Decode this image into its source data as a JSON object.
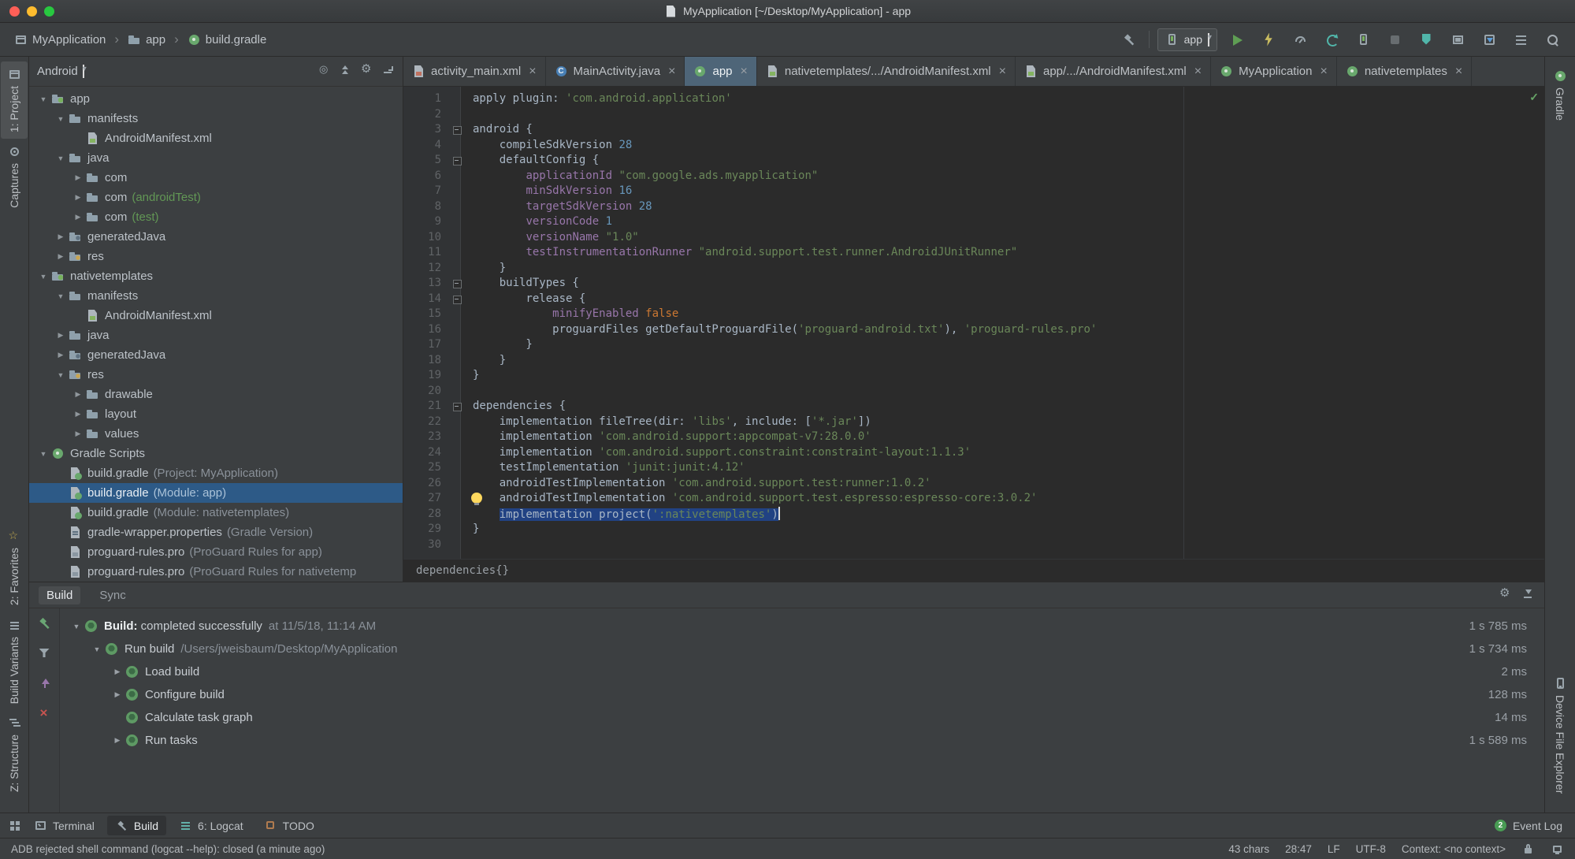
{
  "title_bar": {
    "title": "MyApplication [~/Desktop/MyApplication] - app"
  },
  "toolbar": {
    "breadcrumbs": [
      {
        "label": "MyApplication",
        "icon": "project-window"
      },
      {
        "label": "app",
        "icon": "folder"
      },
      {
        "label": "build.gradle",
        "icon": "gradle"
      }
    ],
    "run_config": "app",
    "icons_before": [
      "build-hammer"
    ],
    "icons_after": [
      "run-play",
      "apply-changes",
      "profiler",
      "gradle-sync",
      "avd-manager",
      "stop",
      "attach-debugger",
      "layout-inspector",
      "sdk-manager",
      "project-structure",
      "search"
    ]
  },
  "left_strip": {
    "top": [
      {
        "label": "1: Project",
        "icon": "project",
        "active": true
      },
      {
        "label": "Captures",
        "icon": "captures",
        "active": false
      }
    ],
    "bottom": [
      {
        "label": "2: Favorites",
        "icon": "favorites",
        "active": false
      },
      {
        "label": "Build Variants",
        "icon": "build-variants",
        "active": false
      },
      {
        "label": "Z: Structure",
        "icon": "structure",
        "active": false
      }
    ]
  },
  "right_strip": {
    "top": [
      {
        "label": "Gradle",
        "icon": "gradle",
        "active": false
      }
    ],
    "bottom": [
      {
        "label": "Device File Explorer",
        "icon": "device-explorer",
        "active": false
      }
    ]
  },
  "project_panel": {
    "view_selector": "Android",
    "header_icons": [
      "locate",
      "collapse-all",
      "settings",
      "hide"
    ],
    "tree": [
      {
        "label": "app",
        "indent": 0,
        "icon": "module",
        "arrow": "down"
      },
      {
        "label": "manifests",
        "indent": 1,
        "icon": "folder",
        "arrow": "down"
      },
      {
        "label": "AndroidManifest.xml",
        "indent": 2,
        "icon": "manifest-file",
        "arrow": null
      },
      {
        "label": "java",
        "indent": 1,
        "icon": "folder",
        "arrow": "down"
      },
      {
        "label": "com",
        "indent": 2,
        "icon": "package",
        "arrow": "right"
      },
      {
        "label": "com",
        "suffix": " (androidTest)",
        "suffix_green": true,
        "indent": 2,
        "icon": "package",
        "arrow": "right"
      },
      {
        "label": "com",
        "suffix": " (test)",
        "suffix_green": true,
        "indent": 2,
        "icon": "package",
        "arrow": "right"
      },
      {
        "label": "generatedJava",
        "indent": 1,
        "icon": "folder-gen",
        "arrow": "right"
      },
      {
        "label": "res",
        "indent": 1,
        "icon": "folder-res",
        "arrow": "right"
      },
      {
        "label": "nativetemplates",
        "indent": 0,
        "icon": "module",
        "arrow": "down"
      },
      {
        "label": "manifests",
        "indent": 1,
        "icon": "folder",
        "arrow": "down"
      },
      {
        "label": "AndroidManifest.xml",
        "indent": 2,
        "icon": "manifest-file",
        "arrow": null
      },
      {
        "label": "java",
        "indent": 1,
        "icon": "folder",
        "arrow": "right"
      },
      {
        "label": "generatedJava",
        "indent": 1,
        "icon": "folder-gen",
        "arrow": "right"
      },
      {
        "label": "res",
        "indent": 1,
        "icon": "folder-res",
        "arrow": "down"
      },
      {
        "label": "drawable",
        "indent": 2,
        "icon": "folder",
        "arrow": "right"
      },
      {
        "label": "layout",
        "indent": 2,
        "icon": "folder",
        "arrow": "right"
      },
      {
        "label": "values",
        "indent": 2,
        "icon": "folder",
        "arrow": "right"
      },
      {
        "label": "Gradle Scripts",
        "indent": 0,
        "icon": "gradle",
        "arrow": "down"
      },
      {
        "label": "build.gradle",
        "suffix": " (Project: MyApplication)",
        "indent": 1,
        "icon": "gradle-file",
        "arrow": null
      },
      {
        "label": "build.gradle",
        "suffix": " (Module: app)",
        "indent": 1,
        "icon": "gradle-file",
        "arrow": null,
        "selected": true
      },
      {
        "label": "build.gradle",
        "suffix": " (Module: nativetemplates)",
        "indent": 1,
        "icon": "gradle-file",
        "arrow": null
      },
      {
        "label": "gradle-wrapper.properties",
        "suffix": " (Gradle Version)",
        "indent": 1,
        "icon": "props-file",
        "arrow": null
      },
      {
        "label": "proguard-rules.pro",
        "suffix": " (ProGuard Rules for app)",
        "indent": 1,
        "icon": "pro-file",
        "arrow": null
      },
      {
        "label": "proguard-rules.pro",
        "suffix": " (ProGuard Rules for nativetemp",
        "indent": 1,
        "icon": "pro-file",
        "arrow": null
      }
    ]
  },
  "editor": {
    "tabs": [
      {
        "label": "activity_main.xml",
        "icon": "xml-file",
        "active": false
      },
      {
        "label": "MainActivity.java",
        "icon": "java-class",
        "active": false
      },
      {
        "label": "app",
        "icon": "gradle",
        "active": true
      },
      {
        "label": "nativetemplates/.../AndroidManifest.xml",
        "icon": "manifest-file",
        "active": false
      },
      {
        "label": "app/.../AndroidManifest.xml",
        "icon": "manifest-file",
        "active": false
      },
      {
        "label": "MyApplication",
        "icon": "gradle",
        "active": false
      },
      {
        "label": "nativetemplates",
        "icon": "gradle",
        "active": false
      }
    ],
    "breadcrumb": "dependencies{}",
    "lines": [
      {
        "n": 1,
        "seg": [
          [
            "apply plugin: ",
            "d"
          ],
          [
            "'com.android.application'",
            "s"
          ]
        ]
      },
      {
        "n": 2,
        "seg": []
      },
      {
        "n": 3,
        "fold": true,
        "seg": [
          [
            "android {",
            "d"
          ]
        ]
      },
      {
        "n": 4,
        "seg": [
          [
            "    compileSdkVersion ",
            "d"
          ],
          [
            "28",
            "n"
          ]
        ]
      },
      {
        "n": 5,
        "fold": true,
        "seg": [
          [
            "    defaultConfig {",
            "d"
          ]
        ]
      },
      {
        "n": 6,
        "seg": [
          [
            "        ",
            "d"
          ],
          [
            "applicationId ",
            "f"
          ],
          [
            "\"com.google.ads.myapplication\"",
            "s"
          ]
        ]
      },
      {
        "n": 7,
        "seg": [
          [
            "        ",
            "d"
          ],
          [
            "minSdkVersion ",
            "f"
          ],
          [
            "16",
            "n"
          ]
        ]
      },
      {
        "n": 8,
        "seg": [
          [
            "        ",
            "d"
          ],
          [
            "targetSdkVersion ",
            "f"
          ],
          [
            "28",
            "n"
          ]
        ]
      },
      {
        "n": 9,
        "seg": [
          [
            "        ",
            "d"
          ],
          [
            "versionCode ",
            "f"
          ],
          [
            "1",
            "n"
          ]
        ]
      },
      {
        "n": 10,
        "seg": [
          [
            "        ",
            "d"
          ],
          [
            "versionName ",
            "f"
          ],
          [
            "\"1.0\"",
            "s"
          ]
        ]
      },
      {
        "n": 11,
        "seg": [
          [
            "        ",
            "d"
          ],
          [
            "testInstrumentationRunner ",
            "f"
          ],
          [
            "\"android.support.test.runner.AndroidJUnitRunner\"",
            "s"
          ]
        ]
      },
      {
        "n": 12,
        "seg": [
          [
            "    }",
            "d"
          ]
        ]
      },
      {
        "n": 13,
        "fold": true,
        "seg": [
          [
            "    buildTypes {",
            "d"
          ]
        ]
      },
      {
        "n": 14,
        "fold": true,
        "seg": [
          [
            "        release {",
            "d"
          ]
        ]
      },
      {
        "n": 15,
        "seg": [
          [
            "            ",
            "d"
          ],
          [
            "minifyEnabled ",
            "f"
          ],
          [
            "false",
            "k"
          ]
        ]
      },
      {
        "n": 16,
        "seg": [
          [
            "            proguardFiles getDefaultProguardFile(",
            "d"
          ],
          [
            "'proguard-android.txt'",
            "s"
          ],
          [
            "), ",
            "d"
          ],
          [
            "'proguard-rules.pro'",
            "s"
          ]
        ]
      },
      {
        "n": 17,
        "seg": [
          [
            "        }",
            "d"
          ]
        ]
      },
      {
        "n": 18,
        "seg": [
          [
            "    }",
            "d"
          ]
        ]
      },
      {
        "n": 19,
        "seg": [
          [
            "}",
            "d"
          ]
        ]
      },
      {
        "n": 20,
        "seg": []
      },
      {
        "n": 21,
        "fold": true,
        "seg": [
          [
            "dependencies {",
            "d"
          ]
        ]
      },
      {
        "n": 22,
        "seg": [
          [
            "    implementation fileTree(dir: ",
            "d"
          ],
          [
            "'libs'",
            "s"
          ],
          [
            ", include: [",
            "d"
          ],
          [
            "'*.jar'",
            "s"
          ],
          [
            "])",
            "d"
          ]
        ]
      },
      {
        "n": 23,
        "seg": [
          [
            "    implementation ",
            "d"
          ],
          [
            "'com.android.support:appcompat-v7:28.0.0'",
            "s"
          ]
        ]
      },
      {
        "n": 24,
        "seg": [
          [
            "    implementation ",
            "d"
          ],
          [
            "'com.android.support.constraint:constraint-layout:1.1.3'",
            "s"
          ]
        ]
      },
      {
        "n": 25,
        "seg": [
          [
            "    testImplementation ",
            "d"
          ],
          [
            "'junit:junit:4.12'",
            "s"
          ]
        ]
      },
      {
        "n": 26,
        "seg": [
          [
            "    androidTestImplementation ",
            "d"
          ],
          [
            "'com.android.support.test:runner:1.0.2'",
            "s"
          ]
        ]
      },
      {
        "n": 27,
        "bulb": true,
        "seg": [
          [
            "    androidTestImplementation ",
            "d"
          ],
          [
            "'com.android.support.test.espresso:espresso-core:3.0.2'",
            "s"
          ]
        ]
      },
      {
        "n": 28,
        "caret": true,
        "seg": [
          [
            "    ",
            "d"
          ],
          [
            "implementation project(",
            "ds"
          ],
          [
            "':nativetemplates'",
            "ss"
          ],
          [
            ")",
            "ds"
          ]
        ]
      },
      {
        "n": 29,
        "seg": [
          [
            "}",
            "d"
          ]
        ]
      },
      {
        "n": 30,
        "seg": []
      }
    ]
  },
  "build_panel": {
    "tabs": [
      {
        "label": "Build",
        "active": true
      },
      {
        "label": "Sync",
        "active": false
      }
    ],
    "header_icons": [
      "settings",
      "minimize"
    ],
    "side_icons": [
      "rerun-build",
      "filter",
      "export",
      "close"
    ],
    "rows": [
      {
        "indent": 0,
        "arrow": "down",
        "bold": "Build:",
        "label": " completed successfully",
        "meta": " at 11/5/18, 11:14 AM",
        "time": "1 s 785 ms"
      },
      {
        "indent": 1,
        "arrow": "down",
        "bold": "",
        "label": "Run build",
        "meta": " /Users/jweisbaum/Desktop/MyApplication",
        "time": "1 s 734 ms"
      },
      {
        "indent": 2,
        "arrow": "right",
        "bold": "",
        "label": "Load build",
        "meta": "",
        "time": "2 ms"
      },
      {
        "indent": 2,
        "arrow": "right",
        "bold": "",
        "label": "Configure build",
        "meta": "",
        "time": "128 ms"
      },
      {
        "indent": 2,
        "arrow": "none",
        "bold": "",
        "label": "Calculate task graph",
        "meta": "",
        "time": "14 ms"
      },
      {
        "indent": 2,
        "arrow": "right",
        "bold": "",
        "label": "Run tasks",
        "meta": "",
        "time": "1 s 589 ms"
      }
    ]
  },
  "bottom_bar": {
    "items": [
      {
        "label": "Terminal",
        "icon": "terminal",
        "active": false
      },
      {
        "label": "Build",
        "icon": "build",
        "active": true
      },
      {
        "label": "6: Logcat",
        "icon": "logcat",
        "active": false
      },
      {
        "label": "TODO",
        "icon": "todo",
        "active": false
      }
    ],
    "event_badge": "2",
    "event_log_label": "Event Log"
  },
  "status_bar": {
    "message": "ADB rejected shell command (logcat --help): closed (a minute ago)",
    "chars": "43 chars",
    "position": "28:47",
    "line_ending": "LF",
    "encoding": "UTF-8",
    "context": "Context: <no context>"
  }
}
